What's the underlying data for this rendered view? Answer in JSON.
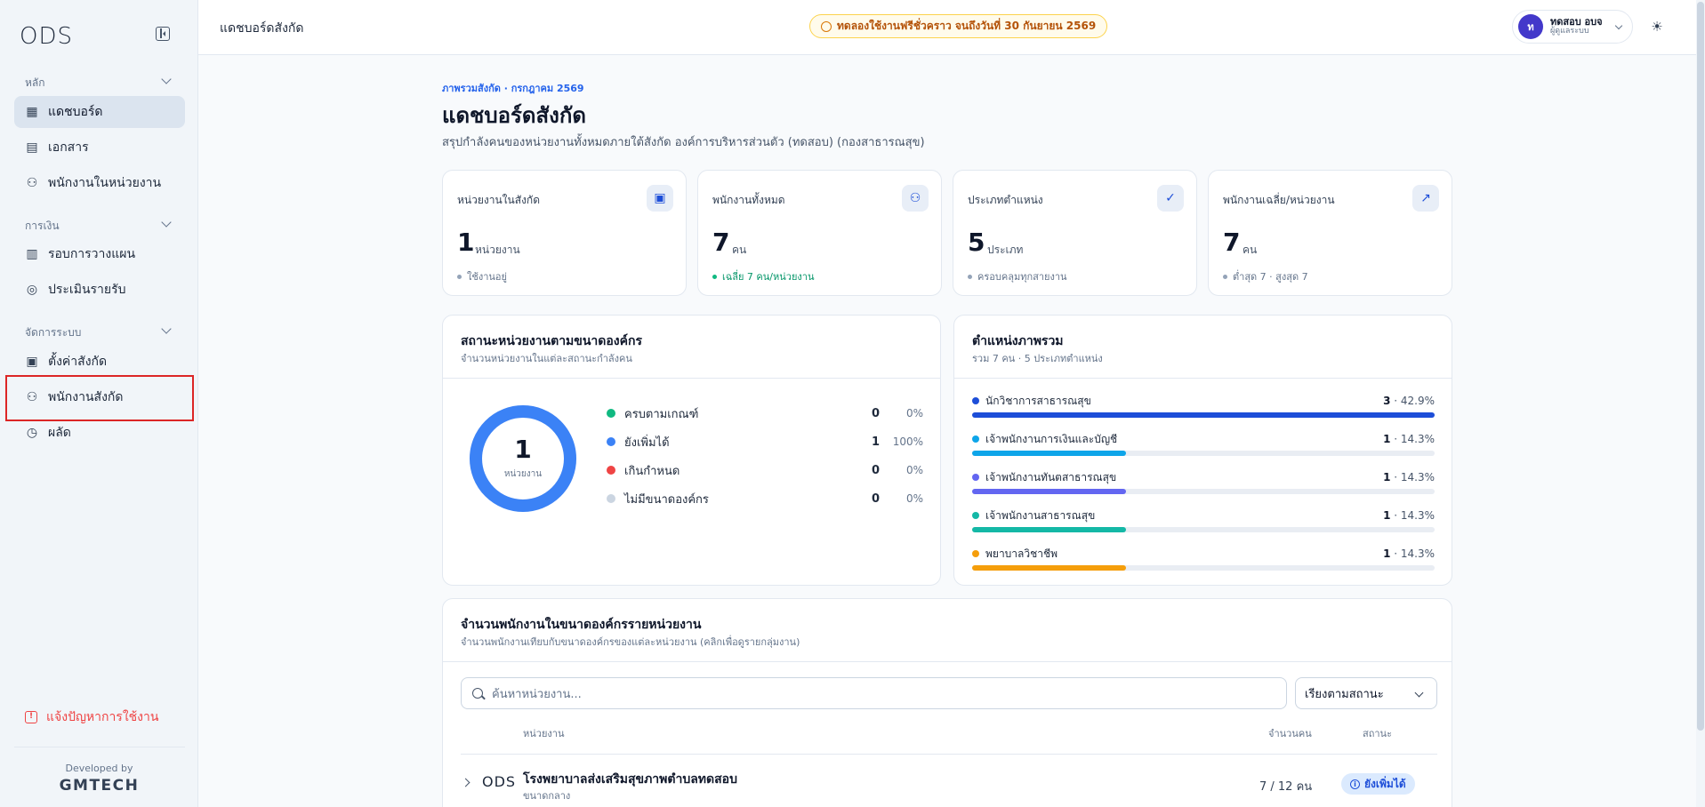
{
  "app": {
    "logo": "ODS"
  },
  "sidebar": {
    "sections": [
      {
        "label": "หลัก"
      },
      {
        "label": "การเงิน"
      },
      {
        "label": "จัดการระบบ"
      }
    ],
    "items": [
      {
        "label": "แดชบอร์ด",
        "icon": "dashboard-icon"
      },
      {
        "label": "เอกสาร",
        "icon": "document-icon"
      },
      {
        "label": "พนักงานในหน่วยงาน",
        "icon": "users-icon"
      },
      {
        "label": "รอบการวางแผน",
        "icon": "clipboard-icon"
      },
      {
        "label": "ประเมินรายรับ",
        "icon": "coins-icon"
      },
      {
        "label": "ตั้งค่าสังกัด",
        "icon": "building-icon"
      },
      {
        "label": "พนักงานสังกัด",
        "icon": "users-icon"
      },
      {
        "label": "ผลัด",
        "icon": "clock-icon"
      }
    ],
    "report": "แจ้งปัญหาการใช้งาน",
    "developed_by": "Developed by",
    "developer": "GMTECH"
  },
  "topbar": {
    "title": "แดชบอร์ดสังกัด",
    "trial": "ทดลองใช้งานฟรีชั่วคราว จนถึงวันที่ 30 กันยายน 2569",
    "user": {
      "initial": "ท",
      "name": "ทดสอบ อบจ",
      "role": "ผู้ดูแลระบบ"
    }
  },
  "header": {
    "breadcrumb": "ภาพรวมสังกัด · กรกฎาคม 2569",
    "title": "แดชบอร์ดสังกัด",
    "subtitle": "สรุปกำลังคนของหน่วยงานทั้งหมดภายใต้สังกัด องค์การบริหารส่วนตัว (ทดสอบ) (กองสาธารณสุข)"
  },
  "stats": [
    {
      "label": "หน่วยงานในสังกัด",
      "value": "1",
      "unit": "หน่วยงาน",
      "note": "ใช้งานอยู่",
      "icon": "building-icon"
    },
    {
      "label": "พนักงานทั้งหมด",
      "value": "7",
      "unit": "คน",
      "note": "เฉลี่ย 7 คน/หน่วยงาน",
      "icon": "users-icon"
    },
    {
      "label": "ประเภทตำแหน่ง",
      "value": "5",
      "unit": "ประเภท",
      "note": "ครอบคลุมทุกสายงาน",
      "icon": "check-circle-icon"
    },
    {
      "label": "พนักงานเฉลี่ย/หน่วยงาน",
      "value": "7",
      "unit": "คน",
      "note": "ต่ำสุด 7 · สูงสุด 7",
      "icon": "trending-up-icon"
    }
  ],
  "status_panel": {
    "title": "สถานะหน่วยงานตามขนาดองค์กร",
    "subtitle": "จำนวนหน่วยงานในแต่ละสถานะกำลังคน",
    "total": "1",
    "total_unit": "หน่วยงาน",
    "items": [
      {
        "label": "ครบตามเกณฑ์",
        "count": "0",
        "pct": "0%",
        "color": "#10b981"
      },
      {
        "label": "ยังเพิ่มได้",
        "count": "1",
        "pct": "100%",
        "color": "#3b82f6"
      },
      {
        "label": "เกินกำหนด",
        "count": "0",
        "pct": "0%",
        "color": "#ef4444"
      },
      {
        "label": "ไม่มีขนาดองค์กร",
        "count": "0",
        "pct": "0%",
        "color": "#cbd5e1"
      }
    ]
  },
  "positions_panel": {
    "title": "ตำแหน่งภาพรวม",
    "subtitle": "รวม 7 คน · 5 ประเภทตำแหน่ง",
    "items": [
      {
        "label": "นักวิชาการสาธารณสุข",
        "count": "3",
        "pct": "42.9%",
        "fraction": 1.0,
        "color": "#1d4ed8"
      },
      {
        "label": "เจ้าพนักงานการเงินและบัญชี",
        "count": "1",
        "pct": "14.3%",
        "fraction": 0.333,
        "color": "#0ea5e9"
      },
      {
        "label": "เจ้าพนักงานทันตสาธารณสุข",
        "count": "1",
        "pct": "14.3%",
        "fraction": 0.333,
        "color": "#6366f1"
      },
      {
        "label": "เจ้าพนักงานสาธารณสุข",
        "count": "1",
        "pct": "14.3%",
        "fraction": 0.333,
        "color": "#14b8a6"
      },
      {
        "label": "พยาบาลวิชาชีพ",
        "count": "1",
        "pct": "14.3%",
        "fraction": 0.333,
        "color": "#f59e0b"
      }
    ]
  },
  "units_panel": {
    "title": "จำนวนพนักงานในขนาดองค์กรรายหน่วยงาน",
    "subtitle": "จำนวนพนักงานเทียบกับขนาดองค์กรของแต่ละหน่วยงาน (คลิกเพื่อดูรายกลุ่มงาน)",
    "search_placeholder": "ค้นหาหน่วยงาน...",
    "sort_value": "เรียงตามสถานะ",
    "columns": {
      "unit": "หน่วยงาน",
      "count": "จำนวนคน",
      "status": "สถานะ"
    },
    "rows": [
      {
        "logo": "ODS",
        "name": "โรงพยาบาลส่งเสริมสุขภาพตำบลทดสอบ",
        "size": "ขนาดกลาง",
        "count": "7 / 12 คน",
        "status": "ยังเพิ่มได้"
      }
    ]
  }
}
